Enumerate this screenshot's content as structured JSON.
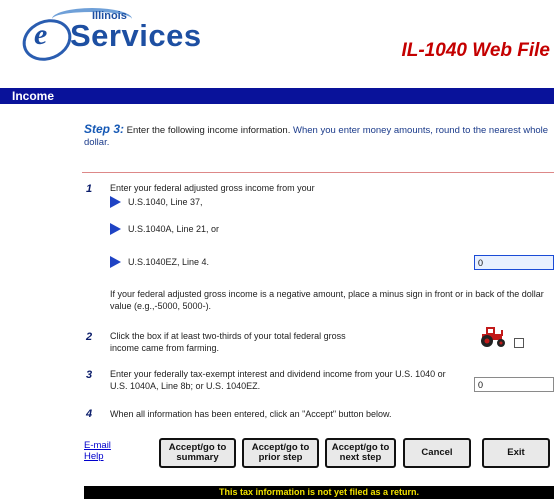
{
  "header": {
    "logo_top": "Illinois",
    "logo_letter": "e",
    "logo_word": "Services",
    "form_title": "IL-1040 Web File"
  },
  "section": {
    "title": "Income"
  },
  "step": {
    "label": "Step 3:",
    "instruction": " Enter the following income information. ",
    "note": "When you enter money amounts, round to the nearest whole dollar."
  },
  "items": {
    "1": {
      "number": "1",
      "text": "Enter your federal adjusted gross income from your",
      "options": [
        "U.S.1040, Line 37,",
        "U.S.1040A, Line 21, or",
        "U.S.1040EZ, Line 4."
      ],
      "value": "0",
      "negative_note": "If your federal adjusted gross income is a negative amount, place a minus sign in front or in back of the dollar value (e.g.,-5000, 5000-)."
    },
    "2": {
      "number": "2",
      "text": "Click the box if at least two-thirds of your total federal gross income came from farming.",
      "icon": "tractor-icon"
    },
    "3": {
      "number": "3",
      "text": "Enter your federally tax-exempt interest and dividend income from your U.S. 1040 or U.S. 1040A, Line 8b; or U.S. 1040EZ.",
      "value": "0"
    },
    "4": {
      "number": "4",
      "text": "When all information has been entered, click an \"Accept\" button below."
    }
  },
  "links": {
    "email": "E-mail",
    "help": "Help"
  },
  "buttons": {
    "summary": "Accept/go to summary",
    "prior": "Accept/go to prior step",
    "next": "Accept/go to next step",
    "cancel": "Cancel",
    "exit": "Exit"
  },
  "footer": {
    "notice": "This tax information is not yet filed as a return."
  },
  "colors": {
    "section_bar": "#09129a",
    "title_red": "#c40000",
    "footer_text": "#f2e200",
    "arrow_blue": "#1f43c4"
  }
}
